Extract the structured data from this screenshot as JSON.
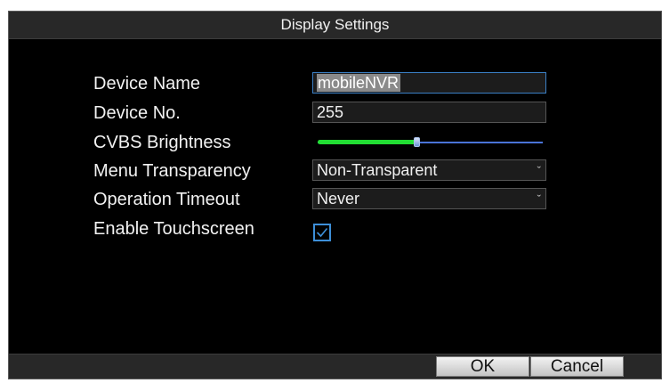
{
  "dialog": {
    "title": "Display Settings"
  },
  "form": {
    "device_name": {
      "label": "Device Name",
      "value": "mobileNVR"
    },
    "device_no": {
      "label": "Device No.",
      "value": "255"
    },
    "cvbs_brightness": {
      "label": "CVBS Brightness",
      "level": 0.44
    },
    "menu_transparency": {
      "label": "Menu Transparency",
      "value": "Non-Transparent"
    },
    "operation_timeout": {
      "label": "Operation Timeout",
      "value": "Never"
    },
    "enable_touchscreen": {
      "label": "Enable Touchscreen",
      "checked": true
    }
  },
  "buttons": {
    "ok": "OK",
    "cancel": "Cancel"
  },
  "icons": {
    "dropdown": "chevron-down-icon",
    "check": "checkmark-icon"
  },
  "colors": {
    "slider_fill": "#22dd33",
    "slider_track": "#4a74d8",
    "focus_border": "#3b7fc4",
    "checkbox": "#3d8fd8"
  }
}
